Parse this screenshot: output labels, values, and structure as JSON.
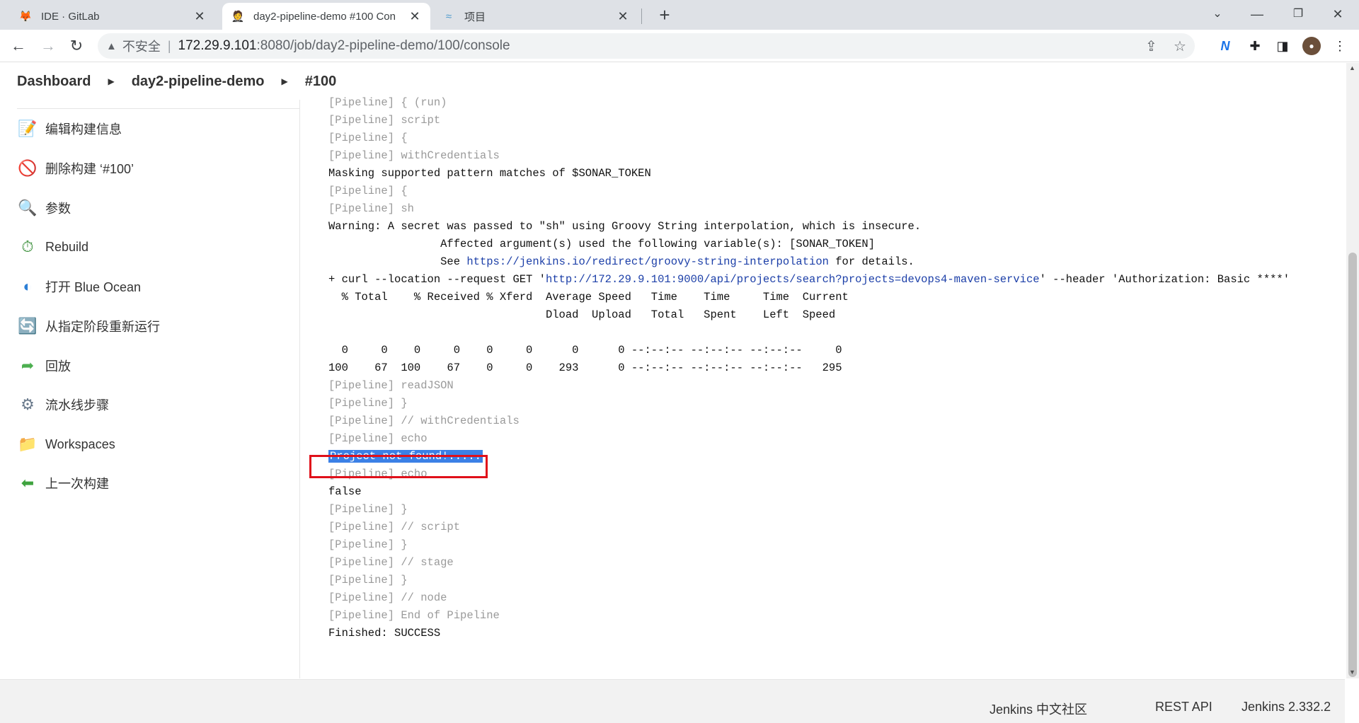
{
  "browser": {
    "tabs": [
      {
        "title": "IDE · GitLab",
        "icon": "gitlab-icon",
        "active": false
      },
      {
        "title": "day2-pipeline-demo #100 Con",
        "icon": "jenkins-icon",
        "active": true
      },
      {
        "title": "项目",
        "icon": "sonarqube-icon",
        "active": false
      }
    ],
    "address": {
      "security_label": "不安全",
      "url_host": "172.29.9.101",
      "url_rest": ":8080/job/day2-pipeline-demo/100/console"
    }
  },
  "breadcrumb": [
    "Dashboard",
    "day2-pipeline-demo",
    "#100"
  ],
  "sidebar": {
    "items": [
      {
        "label": "编辑构建信息",
        "icon": "notepad-icon"
      },
      {
        "label": "删除构建 ‘#100’",
        "icon": "no-entry-icon"
      },
      {
        "label": "参数",
        "icon": "magnifier-icon"
      },
      {
        "label": "Rebuild",
        "icon": "rebuild-icon"
      },
      {
        "label": "打开 Blue Ocean",
        "icon": "blue-ocean-icon"
      },
      {
        "label": "从指定阶段重新运行",
        "icon": "refresh-icon"
      },
      {
        "label": "回放",
        "icon": "replay-arrow-icon"
      },
      {
        "label": "流水线步骤",
        "icon": "gear-icon"
      },
      {
        "label": "Workspaces",
        "icon": "folder-icon"
      },
      {
        "label": "上一次构建",
        "icon": "back-arrow-icon"
      }
    ]
  },
  "console": {
    "lines": [
      {
        "text": "[Pipeline] { (run)",
        "style": "pl"
      },
      {
        "text": "[Pipeline] script",
        "style": "pl"
      },
      {
        "text": "[Pipeline] {",
        "style": "pl"
      },
      {
        "text": "[Pipeline] withCredentials",
        "style": "pl"
      },
      {
        "text": "Masking supported pattern matches of $SONAR_TOKEN",
        "style": "out"
      },
      {
        "text": "[Pipeline] {",
        "style": "pl"
      },
      {
        "text": "[Pipeline] sh",
        "style": "pl"
      },
      {
        "text": "Warning: A secret was passed to \"sh\" using Groovy String interpolation, which is insecure.",
        "style": "out"
      },
      {
        "text": "\t\t Affected argument(s) used the following variable(s): [SONAR_TOKEN]",
        "style": "out"
      },
      {
        "text": "\t\t See ",
        "link": "https://jenkins.io/redirect/groovy-string-interpolation",
        "after": " for details.",
        "style": "out"
      },
      {
        "text": "+ curl --location --request GET '",
        "link": "http://172.29.9.101:9000/api/projects/search?projects=devops4-maven-service",
        "after": "' --header 'Authorization: Basic ****'",
        "style": "out"
      },
      {
        "text": "  % Total    % Received % Xferd  Average Speed   Time    Time     Time  Current",
        "style": "out"
      },
      {
        "text": "                                 Dload  Upload   Total   Spent    Left  Speed",
        "style": "out"
      },
      {
        "text": "",
        "style": "out"
      },
      {
        "text": "  0     0    0     0    0     0      0      0 --:--:-- --:--:-- --:--:--     0",
        "style": "out"
      },
      {
        "text": "100    67  100    67    0     0    293      0 --:--:-- --:--:-- --:--:--   295",
        "style": "out"
      },
      {
        "text": "[Pipeline] readJSON",
        "style": "pl"
      },
      {
        "text": "[Pipeline] }",
        "style": "pl"
      },
      {
        "text": "[Pipeline] // withCredentials",
        "style": "pl"
      },
      {
        "text": "[Pipeline] echo",
        "style": "pl"
      },
      {
        "text": "Project not found!.....",
        "style": "highlight"
      },
      {
        "text": "[Pipeline] echo",
        "style": "pl"
      },
      {
        "text": "false",
        "style": "out"
      },
      {
        "text": "[Pipeline] }",
        "style": "pl"
      },
      {
        "text": "[Pipeline] // script",
        "style": "pl"
      },
      {
        "text": "[Pipeline] }",
        "style": "pl"
      },
      {
        "text": "[Pipeline] // stage",
        "style": "pl"
      },
      {
        "text": "[Pipeline] }",
        "style": "pl"
      },
      {
        "text": "[Pipeline] // node",
        "style": "pl"
      },
      {
        "text": "[Pipeline] End of Pipeline",
        "style": "pl"
      },
      {
        "text": "Finished: SUCCESS",
        "style": "out"
      }
    ]
  },
  "footer": {
    "community": "Jenkins 中文社区",
    "rest_api": "REST API",
    "version": "Jenkins 2.332.2"
  }
}
